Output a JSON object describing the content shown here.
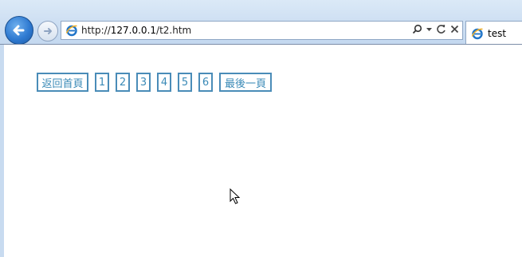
{
  "browser": {
    "address": {
      "prefix": "http://",
      "host": "127.0.0.1",
      "path": "/t2.htm"
    },
    "tab_title": "test"
  },
  "pagination": {
    "first_label": "返回首頁",
    "pages": [
      "1",
      "2",
      "3",
      "4",
      "5",
      "6"
    ],
    "last_label": "最後一頁"
  },
  "colors": {
    "pager_border": "#4a8cb8",
    "pager_text": "#3a8ab7",
    "chrome_bg": "#cfe0f3"
  }
}
